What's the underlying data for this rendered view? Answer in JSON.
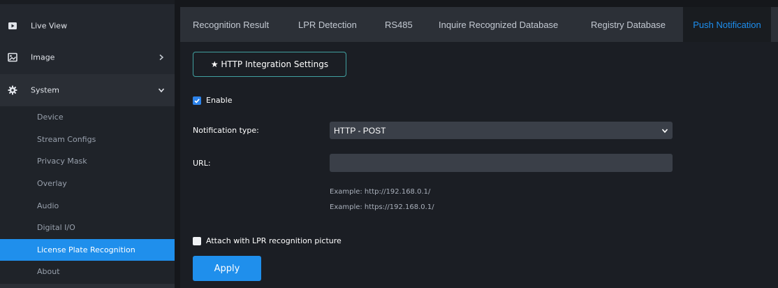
{
  "sidebar": {
    "items": [
      {
        "label": "Live View",
        "icon": "video-icon"
      },
      {
        "label": "Image",
        "icon": "image-icon"
      },
      {
        "label": "System",
        "icon": "gear-icon"
      }
    ],
    "sub_items": [
      {
        "label": "Device"
      },
      {
        "label": "Stream Configs"
      },
      {
        "label": "Privacy Mask"
      },
      {
        "label": "Overlay"
      },
      {
        "label": "Audio"
      },
      {
        "label": "Digital I/O"
      },
      {
        "label": "License Plate Recognition",
        "active": true
      },
      {
        "label": "About"
      }
    ]
  },
  "tabs": [
    {
      "label": "Recognition Result"
    },
    {
      "label": "LPR Detection"
    },
    {
      "label": "RS485"
    },
    {
      "label": "Inquire Recognized Database"
    },
    {
      "label": "Registry Database"
    },
    {
      "label": "Push Notification",
      "active": true
    }
  ],
  "content": {
    "http_button": "★ HTTP Integration Settings",
    "enable_label": "Enable",
    "enable_checked": true,
    "notification_type_label": "Notification type:",
    "notification_type_value": "HTTP - POST",
    "url_label": "URL:",
    "url_value": "",
    "example1": "Example: http://192.168.0.1/",
    "example2": "Example: https://192.168.0.1/",
    "attach_label": "Attach with LPR recognition picture",
    "attach_checked": false,
    "apply_label": "Apply"
  },
  "colors": {
    "accent": "#1f8fec",
    "active_tab_text": "#1d8ff0",
    "http_button_border": "#41a0a0"
  }
}
